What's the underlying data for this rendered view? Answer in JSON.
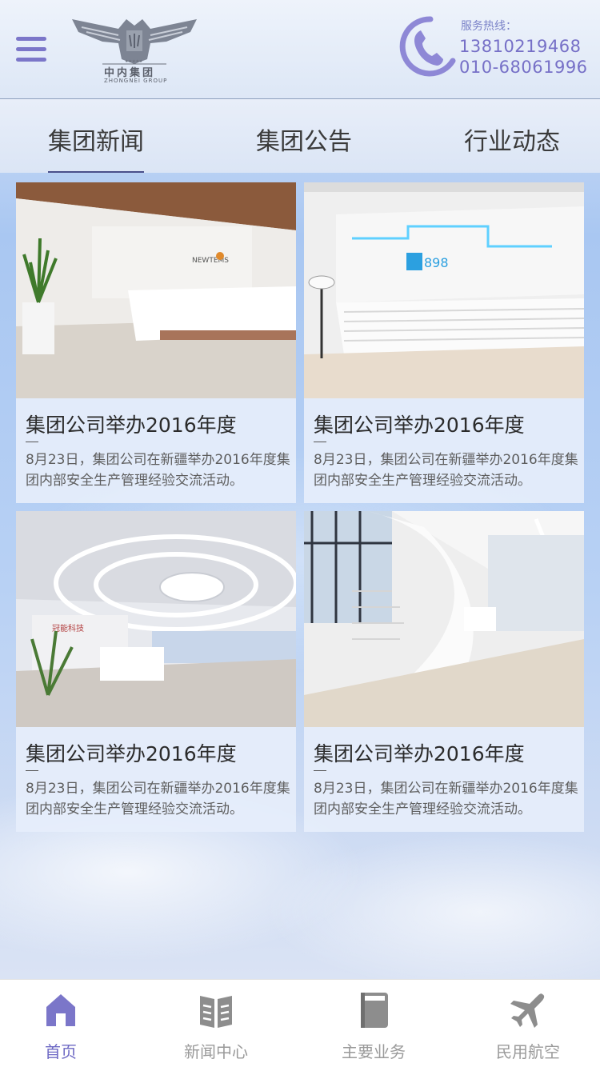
{
  "header": {
    "logo_cn": "中内集团",
    "logo_en": "ZHONGNEI GROUP",
    "hotline_label": "服务热线：",
    "hotline_1": "13810219468",
    "hotline_2": "010-68061996",
    "icons": {
      "menu": "hamburger-menu-icon",
      "phone": "phone-icon",
      "logo": "eagle-logo"
    }
  },
  "tabs": [
    {
      "label": "集团新闻",
      "active": true
    },
    {
      "label": "集团公告",
      "active": false
    },
    {
      "label": "行业动态",
      "active": false
    }
  ],
  "cards": [
    {
      "title": "集团公司举办2016年度",
      "desc": "8月23日，集团公司在新疆举办2016年度集团内部安全生产管理经验交流活动。",
      "image": "office-reception-photo"
    },
    {
      "title": "集团公司举办2016年度",
      "desc": "8月23日，集团公司在新疆举办2016年度集团内部安全生产管理经验交流活动。",
      "image": "lobby-reception-photo"
    },
    {
      "title": "集团公司举办2016年度",
      "desc": "8月23日，集团公司在新疆举办2016年度集团内部安全生产管理经验交流活动。",
      "image": "ceiling-lobby-photo"
    },
    {
      "title": "集团公司举办2016年度",
      "desc": "8月23日，集团公司在新疆举办2016年度集团内部安全生产管理经验交流活动。",
      "image": "spiral-staircase-photo"
    }
  ],
  "bottom_nav": [
    {
      "label": "首页",
      "icon": "home-icon",
      "active": true
    },
    {
      "label": "新闻中心",
      "icon": "book-icon",
      "active": false
    },
    {
      "label": "主要业务",
      "icon": "binder-icon",
      "active": false
    },
    {
      "label": "民用航空",
      "icon": "airplane-icon",
      "active": false
    }
  ],
  "colors": {
    "accent": "#6d68c4",
    "inactive": "#9a9a9a",
    "text": "#2b2b2b"
  }
}
